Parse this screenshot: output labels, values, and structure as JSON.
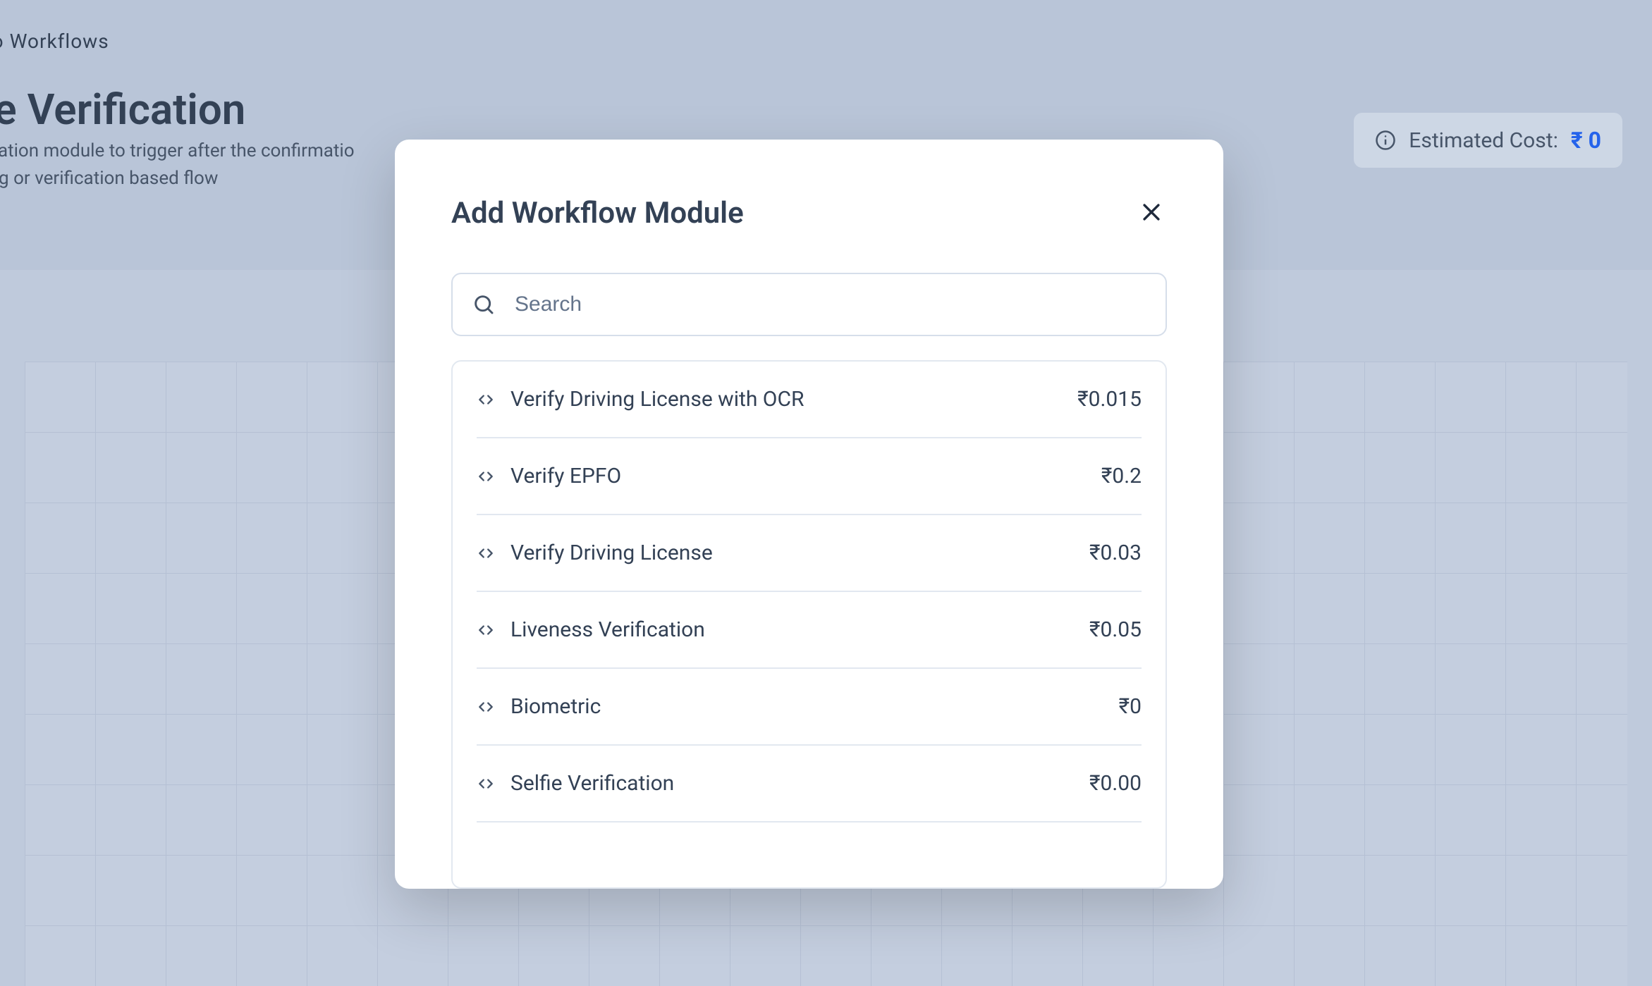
{
  "background": {
    "back_link": "ck to Workflows",
    "title": "lfie Verification",
    "subtitle_line1": "erification module to trigger after the confirmatio",
    "subtitle_line2": "arding or verification based flow",
    "cost_label": "Estimated Cost:",
    "cost_value": "₹ 0"
  },
  "modal": {
    "title": "Add Workflow Module",
    "search_placeholder": "Search",
    "items": [
      {
        "name": "Verify Driving License with OCR",
        "price": "₹0.015"
      },
      {
        "name": "Verify EPFO",
        "price": "₹0.2"
      },
      {
        "name": "Verify Driving License",
        "price": "₹0.03"
      },
      {
        "name": "Liveness Verification",
        "price": "₹0.05"
      },
      {
        "name": "Biometric",
        "price": "₹0"
      },
      {
        "name": "Selfie Verification",
        "price": "₹0.00"
      }
    ]
  }
}
